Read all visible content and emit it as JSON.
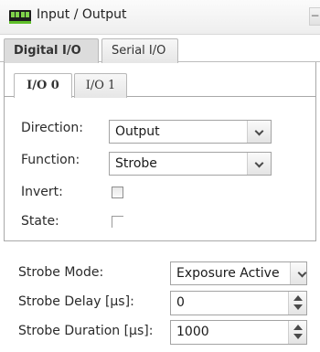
{
  "window": {
    "title": "Input / Output",
    "icon": "io-connector-icon",
    "collapse_glyph": "−"
  },
  "tabs": [
    {
      "label": "Digital I/O",
      "active": true
    },
    {
      "label": "Serial I/O",
      "active": false
    }
  ],
  "io_tabs": [
    {
      "label": "I/O 0",
      "active": true
    },
    {
      "label": "I/O 1",
      "active": false
    }
  ],
  "io_settings": {
    "direction": {
      "label": "Direction:",
      "value": "Output"
    },
    "function": {
      "label": "Function:",
      "value": "Strobe"
    },
    "invert": {
      "label": "Invert:",
      "checked": false
    },
    "state": {
      "label": "State:",
      "checked": false,
      "enabled": false
    }
  },
  "strobe": {
    "mode": {
      "label": "Strobe Mode:",
      "value": "Exposure Active"
    },
    "delay": {
      "label": "Strobe Delay [µs]:",
      "value": "0"
    },
    "duration": {
      "label": "Strobe Duration [µs]:",
      "value": "1000"
    }
  },
  "colors": {
    "icon_green": "#7fd24a",
    "active_tab": "#dcdcdc"
  }
}
